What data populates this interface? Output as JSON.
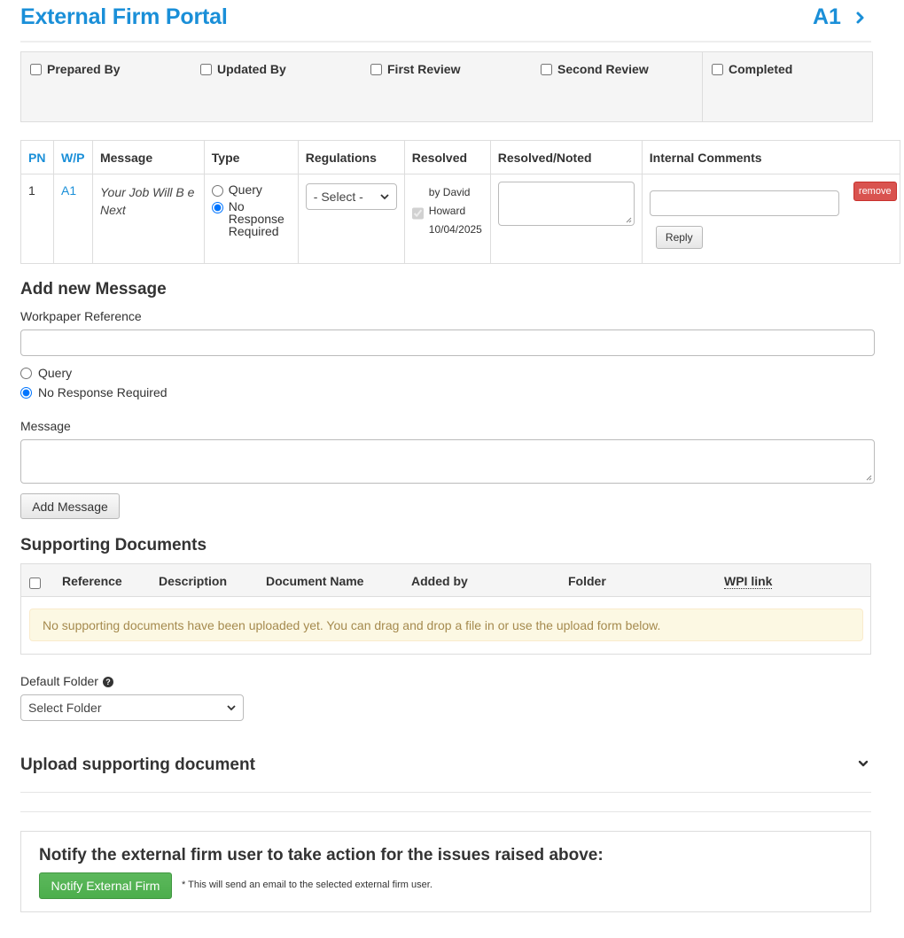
{
  "header": {
    "title": "External Firm Portal",
    "workpaper": "A1"
  },
  "signoff": {
    "items": [
      "Prepared By",
      "Updated By",
      "First Review",
      "Second Review",
      "Completed"
    ]
  },
  "messages_table": {
    "columns": [
      "PN",
      "W/P",
      "Message",
      "Type",
      "Regulations",
      "Resolved",
      "Resolved/Noted",
      "Internal Comments"
    ],
    "rows": [
      {
        "pn": "1",
        "wp": "A1",
        "message": "Your Job Will B e Next",
        "type_options": [
          "Query",
          "No Response Required"
        ],
        "type_selected": "No Response Required",
        "regulations_selected": "- Select -",
        "resolved_by": "by David Howard",
        "resolved_date": "10/04/2025",
        "remove_label": "remove",
        "reply_label": "Reply"
      }
    ]
  },
  "add_message": {
    "heading": "Add new Message",
    "wp_ref_label": "Workpaper Reference",
    "options": [
      "Query",
      "No Response Required"
    ],
    "selected": "No Response Required",
    "message_label": "Message",
    "button_label": "Add Message"
  },
  "supporting_docs": {
    "heading": "Supporting Documents",
    "columns": [
      "Reference",
      "Description",
      "Document Name",
      "Added by",
      "Folder",
      "WPI link"
    ],
    "empty_message": "No supporting documents have been uploaded yet. You can drag and drop a file in or use the upload form below.",
    "default_folder_label": "Default Folder",
    "folder_selected": "Select Folder"
  },
  "upload": {
    "heading": "Upload supporting document"
  },
  "notify": {
    "heading": "Notify the external firm user to take action for the issues raised above:",
    "button_label": "Notify External Firm",
    "note": "* This will send an email to the selected external firm user."
  },
  "colors": {
    "primary": "#1a8fd8",
    "danger": "#d9534f",
    "success": "#5cb85c",
    "alert_bg": "#fcf8e3",
    "alert_text": "#a58a4e"
  }
}
